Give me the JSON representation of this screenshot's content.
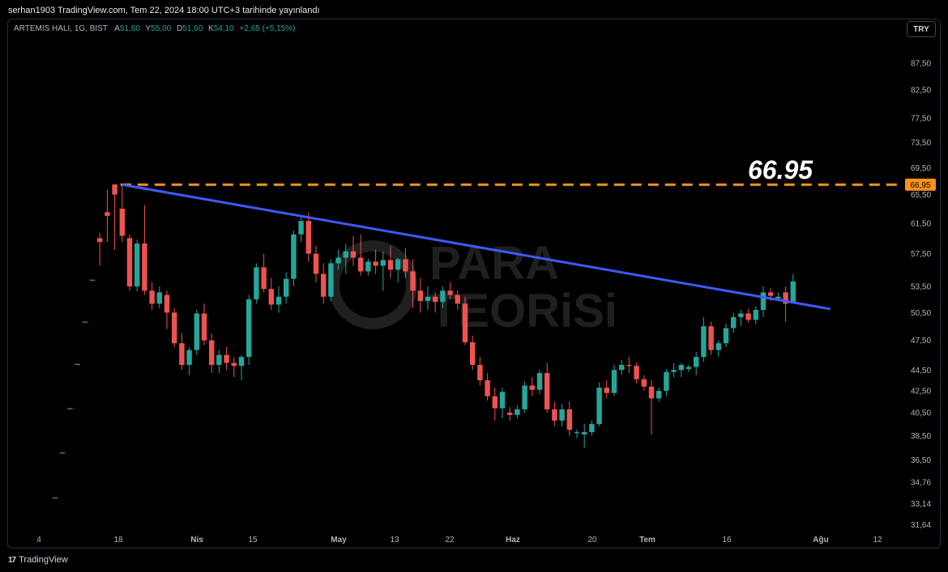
{
  "header": {
    "publish_line": "serhan1903 TradingView.com, Tem 22, 2024 18:00 UTC+3 tarihinde yayınlandı"
  },
  "legend": {
    "symbol": "ARTEMIS HALI, 1G, BIST",
    "open_label": "A",
    "open_value": "51,60",
    "high_label": "Y",
    "high_value": "55,00",
    "low_label": "D",
    "low_value": "51,60",
    "close_label": "K",
    "close_value": "54,10",
    "change": "+2,65 (+5,15%)"
  },
  "currency_button": "TRY",
  "footer": {
    "brand": "TradingView"
  },
  "watermark": {
    "line1": "PARA",
    "line2": "TEORiSi"
  },
  "colors": {
    "up": "#26a69a",
    "down": "#ef5350",
    "trend": "#3d5afe",
    "resistance": "#f7931a",
    "panel_border": "#2a2e39"
  },
  "chart_data": {
    "type": "candlestick",
    "y_scale": "log",
    "ylim": [
      31.0,
      92.0
    ],
    "y_ticks": [
      "87,50",
      "82,50",
      "77,50",
      "73,50",
      "69,50",
      "65,50",
      "61,50",
      "57,50",
      "53,50",
      "50,50",
      "47,50",
      "44,50",
      "42,50",
      "40,50",
      "38,50",
      "36,50",
      "34,76",
      "33,14",
      "31,64"
    ],
    "x_ticks": [
      "4",
      "18",
      "Nis",
      "15",
      "May",
      "13",
      "22",
      "Haz",
      "20",
      "Tem",
      "16",
      "Ağu",
      "12"
    ],
    "resistance": {
      "value": 66.95,
      "label": "66,95",
      "annotation": "66.95"
    },
    "trendline": {
      "from_index": 9,
      "from_value": 66.95,
      "to_index": 104,
      "to_value": 50.9
    },
    "candles": [
      [
        33.6,
        33.6,
        33.6,
        33.6
      ],
      [
        37.1,
        37.1,
        37.1,
        37.1
      ],
      [
        40.9,
        40.9,
        40.9,
        40.9
      ],
      [
        45.1,
        45.1,
        45.1,
        45.1
      ],
      [
        49.5,
        49.5,
        49.5,
        49.5
      ],
      [
        54.3,
        54.3,
        54.3,
        54.3
      ],
      [
        59.5,
        60.2,
        56.0,
        59.0
      ],
      [
        63.0,
        66.2,
        59.0,
        62.5
      ],
      [
        67.0,
        67.0,
        58.0,
        65.5
      ],
      [
        63.5,
        66.9,
        59.0,
        59.8
      ],
      [
        59.5,
        60.0,
        53.0,
        53.5
      ],
      [
        53.5,
        59.3,
        52.9,
        58.8
      ],
      [
        58.8,
        64.0,
        52.5,
        53.0
      ],
      [
        53.0,
        54.0,
        50.8,
        51.5
      ],
      [
        51.5,
        53.5,
        51.0,
        52.8
      ],
      [
        52.5,
        53.0,
        48.7,
        50.5
      ],
      [
        50.5,
        51.0,
        46.8,
        47.2
      ],
      [
        47.2,
        48.3,
        44.5,
        45.0
      ],
      [
        45.0,
        46.8,
        44.0,
        46.5
      ],
      [
        46.5,
        50.8,
        46.0,
        50.4
      ],
      [
        50.4,
        51.5,
        47.0,
        47.5
      ],
      [
        47.5,
        48.2,
        44.2,
        45.0
      ],
      [
        45.0,
        46.5,
        44.2,
        46.0
      ],
      [
        46.0,
        46.8,
        44.5,
        45.2
      ],
      [
        45.2,
        45.8,
        43.8,
        44.9
      ],
      [
        44.9,
        46.0,
        43.5,
        45.8
      ],
      [
        45.8,
        52.5,
        45.0,
        52.0
      ],
      [
        52.0,
        56.3,
        51.5,
        55.8
      ],
      [
        55.8,
        57.5,
        52.8,
        53.2
      ],
      [
        53.2,
        54.5,
        50.8,
        51.4
      ],
      [
        51.4,
        53.5,
        50.5,
        52.3
      ],
      [
        52.3,
        55.2,
        51.5,
        54.4
      ],
      [
        54.4,
        60.5,
        53.5,
        60.0
      ],
      [
        60.0,
        62.5,
        59.0,
        61.8
      ],
      [
        61.8,
        63.0,
        56.5,
        57.5
      ],
      [
        57.5,
        58.5,
        54.0,
        55.0
      ],
      [
        55.0,
        56.3,
        51.5,
        52.3
      ],
      [
        52.3,
        56.8,
        51.8,
        56.3
      ],
      [
        56.3,
        58.0,
        55.5,
        57.0
      ],
      [
        57.0,
        58.8,
        55.0,
        57.8
      ],
      [
        57.8,
        59.8,
        56.0,
        57.0
      ],
      [
        57.0,
        60.0,
        54.8,
        55.3
      ],
      [
        55.3,
        56.9,
        54.8,
        56.5
      ],
      [
        56.5,
        58.0,
        55.0,
        56.0
      ],
      [
        56.0,
        57.8,
        53.0,
        56.7
      ],
      [
        56.7,
        58.5,
        54.5,
        55.5
      ],
      [
        55.5,
        57.0,
        54.0,
        56.8
      ],
      [
        56.8,
        58.2,
        54.5,
        55.3
      ],
      [
        55.3,
        56.8,
        51.0,
        53.0
      ],
      [
        53.0,
        54.5,
        50.5,
        51.8
      ],
      [
        51.8,
        53.5,
        50.8,
        52.3
      ],
      [
        52.3,
        52.8,
        50.5,
        51.7
      ],
      [
        51.7,
        53.5,
        51.0,
        53.0
      ],
      [
        53.0,
        54.0,
        52.0,
        52.5
      ],
      [
        52.5,
        53.0,
        50.8,
        51.5
      ],
      [
        51.5,
        52.3,
        47.0,
        47.3
      ],
      [
        47.3,
        48.0,
        44.5,
        45.0
      ],
      [
        45.0,
        45.8,
        43.0,
        43.5
      ],
      [
        43.5,
        44.2,
        41.6,
        42.0
      ],
      [
        42.0,
        42.8,
        39.8,
        40.9
      ],
      [
        40.9,
        42.8,
        40.0,
        42.4
      ],
      [
        40.5,
        41.0,
        39.8,
        40.3
      ],
      [
        40.3,
        41.2,
        40.0,
        40.8
      ],
      [
        40.8,
        43.4,
        40.5,
        43.0
      ],
      [
        43.0,
        43.8,
        42.0,
        42.6
      ],
      [
        42.6,
        44.5,
        42.2,
        44.2
      ],
      [
        44.2,
        45.2,
        40.5,
        40.8
      ],
      [
        40.8,
        41.5,
        39.3,
        39.8
      ],
      [
        39.8,
        41.3,
        39.3,
        40.8
      ],
      [
        40.8,
        41.5,
        38.5,
        39.0
      ],
      [
        38.8,
        39.0,
        38.3,
        38.8
      ],
      [
        38.6,
        39.5,
        37.5,
        38.8
      ],
      [
        38.8,
        39.8,
        38.5,
        39.5
      ],
      [
        39.5,
        43.3,
        39.3,
        42.8
      ],
      [
        42.8,
        43.5,
        41.8,
        42.3
      ],
      [
        42.3,
        45.0,
        42.0,
        44.5
      ],
      [
        44.5,
        45.5,
        44.0,
        45.0
      ],
      [
        45.0,
        45.8,
        44.2,
        44.9
      ],
      [
        44.9,
        45.2,
        43.2,
        43.6
      ],
      [
        43.6,
        44.0,
        42.5,
        42.9
      ],
      [
        42.9,
        43.5,
        38.6,
        41.8
      ],
      [
        41.8,
        42.8,
        41.5,
        42.5
      ],
      [
        42.5,
        44.6,
        42.0,
        44.3
      ],
      [
        44.3,
        45.2,
        43.8,
        44.5
      ],
      [
        44.5,
        45.2,
        43.8,
        45.0
      ],
      [
        44.6,
        45.0,
        44.3,
        44.8
      ],
      [
        44.8,
        46.3,
        44.0,
        45.8
      ],
      [
        45.8,
        50.0,
        45.3,
        49.0
      ],
      [
        49.0,
        49.5,
        46.0,
        46.5
      ],
      [
        46.5,
        47.5,
        45.8,
        47.2
      ],
      [
        47.2,
        49.3,
        46.8,
        48.8
      ],
      [
        48.8,
        50.5,
        48.3,
        50.0
      ],
      [
        50.0,
        50.8,
        49.0,
        50.4
      ],
      [
        50.4,
        50.9,
        49.4,
        49.7
      ],
      [
        49.7,
        51.2,
        49.2,
        50.8
      ],
      [
        50.8,
        53.5,
        50.0,
        52.8
      ],
      [
        52.8,
        53.3,
        51.8,
        52.4
      ],
      [
        52.1,
        52.8,
        51.8,
        52.3
      ],
      [
        52.8,
        53.5,
        49.5,
        51.5
      ],
      [
        51.6,
        55.0,
        51.6,
        54.1
      ]
    ]
  }
}
